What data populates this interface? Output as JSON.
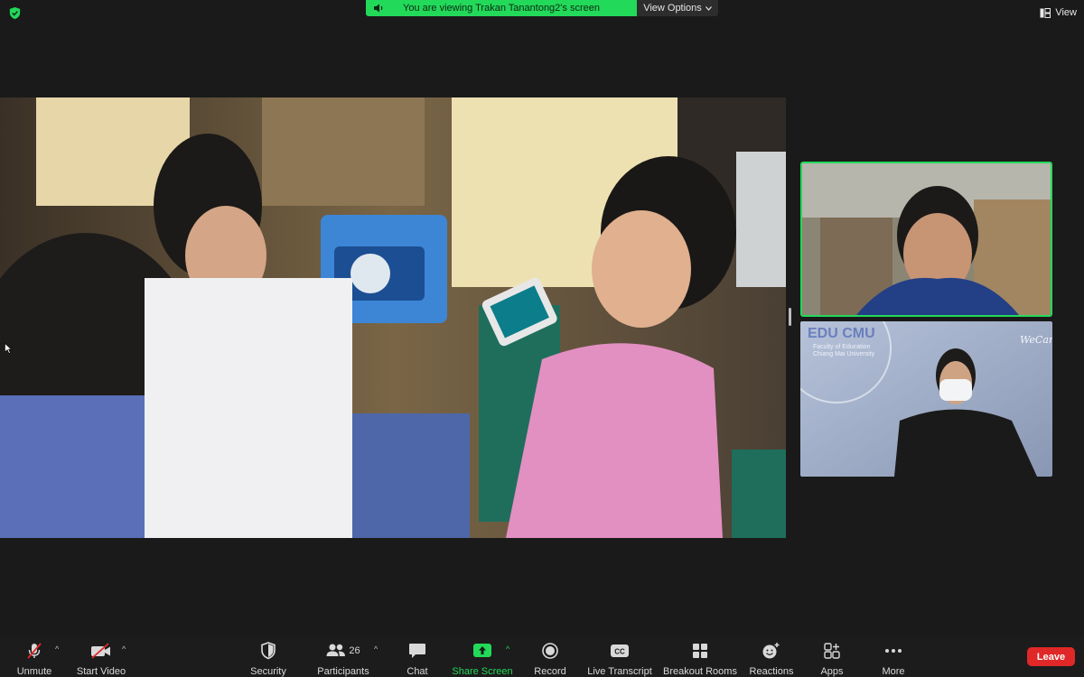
{
  "banner": {
    "text": "You are viewing Trakan Tanantong2's screen",
    "view_options": "View Options",
    "color": "#23d959"
  },
  "top_right": {
    "view_label": "View"
  },
  "toolbar": {
    "unmute": "Unmute",
    "start_video": "Start Video",
    "security": "Security",
    "participants": "Participants",
    "participant_count": "26",
    "chat": "Chat",
    "share_screen": "Share Screen",
    "record": "Record",
    "live_transcript": "Live Transcript",
    "breakout_rooms": "Breakout Rooms",
    "reactions": "Reactions",
    "apps": "Apps",
    "more": "More",
    "leave": "Leave"
  },
  "thumbnails": {
    "logo_text": "EDU CMU",
    "logo_sub1": "Faculty of Education",
    "logo_sub2": "Chiang Mai University",
    "brand": "WeCan"
  },
  "colors": {
    "accent_green": "#23d959",
    "leave_red": "#e02828",
    "background": "#1a1a1a"
  },
  "icons": [
    "shield-check-icon",
    "speaker-icon",
    "chevron-down-icon",
    "view-grid-icon",
    "mic-muted-icon",
    "video-off-icon",
    "shield-icon",
    "participants-icon",
    "chat-icon",
    "share-up-arrow-icon",
    "record-icon",
    "cc-icon",
    "breakout-grid-icon",
    "reaction-smile-icon",
    "apps-icon",
    "more-dots-icon"
  ]
}
